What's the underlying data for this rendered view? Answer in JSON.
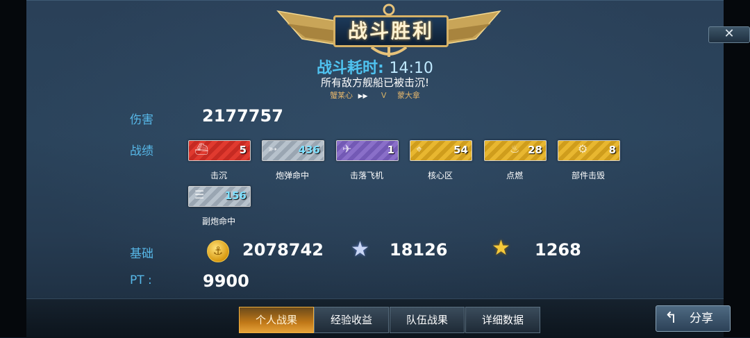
{
  "header": {
    "title": "战斗胜利",
    "close_label": "✕"
  },
  "battle": {
    "duration_label": "战斗耗时:",
    "duration_value": "14:10",
    "result": "所有敌方舰船已被击沉!",
    "player_left": "蟹某心",
    "vs": "V",
    "player_right": "蒙大拿"
  },
  "stats": {
    "damage_label": "伤害",
    "damage_value": "2177757",
    "achievements_label": "战绩",
    "achievements": [
      {
        "label": "击沉",
        "value": "5",
        "color": "#e03a2f",
        "icon": "ship-sinking-icon"
      },
      {
        "label": "炮弹命中",
        "value": "436",
        "color": "#b7c2cc",
        "icon": "shell-hit-icon"
      },
      {
        "label": "击落飞机",
        "value": "1",
        "color": "#8a6fc9",
        "icon": "plane-down-icon"
      },
      {
        "label": "核心区",
        "value": "54",
        "color": "#e8b730",
        "icon": "citadel-icon"
      },
      {
        "label": "点燃",
        "value": "28",
        "color": "#e8b730",
        "icon": "fire-icon"
      },
      {
        "label": "部件击毁",
        "value": "8",
        "color": "#e8b730",
        "icon": "gear-icon"
      },
      {
        "label": "副炮命中",
        "value": "156",
        "color": "#b7c2cc",
        "icon": "secondary-gun-icon"
      }
    ],
    "base_label": "基础",
    "coins": "2078742",
    "silver_star": "18126",
    "gold_star": "1268",
    "pt_label": "PT :",
    "pt_value": "9900"
  },
  "tabs": [
    "个人战果",
    "经验收益",
    "队伍战果",
    "详细数据"
  ],
  "active_tab": "个人战果",
  "share_label": "分享"
}
